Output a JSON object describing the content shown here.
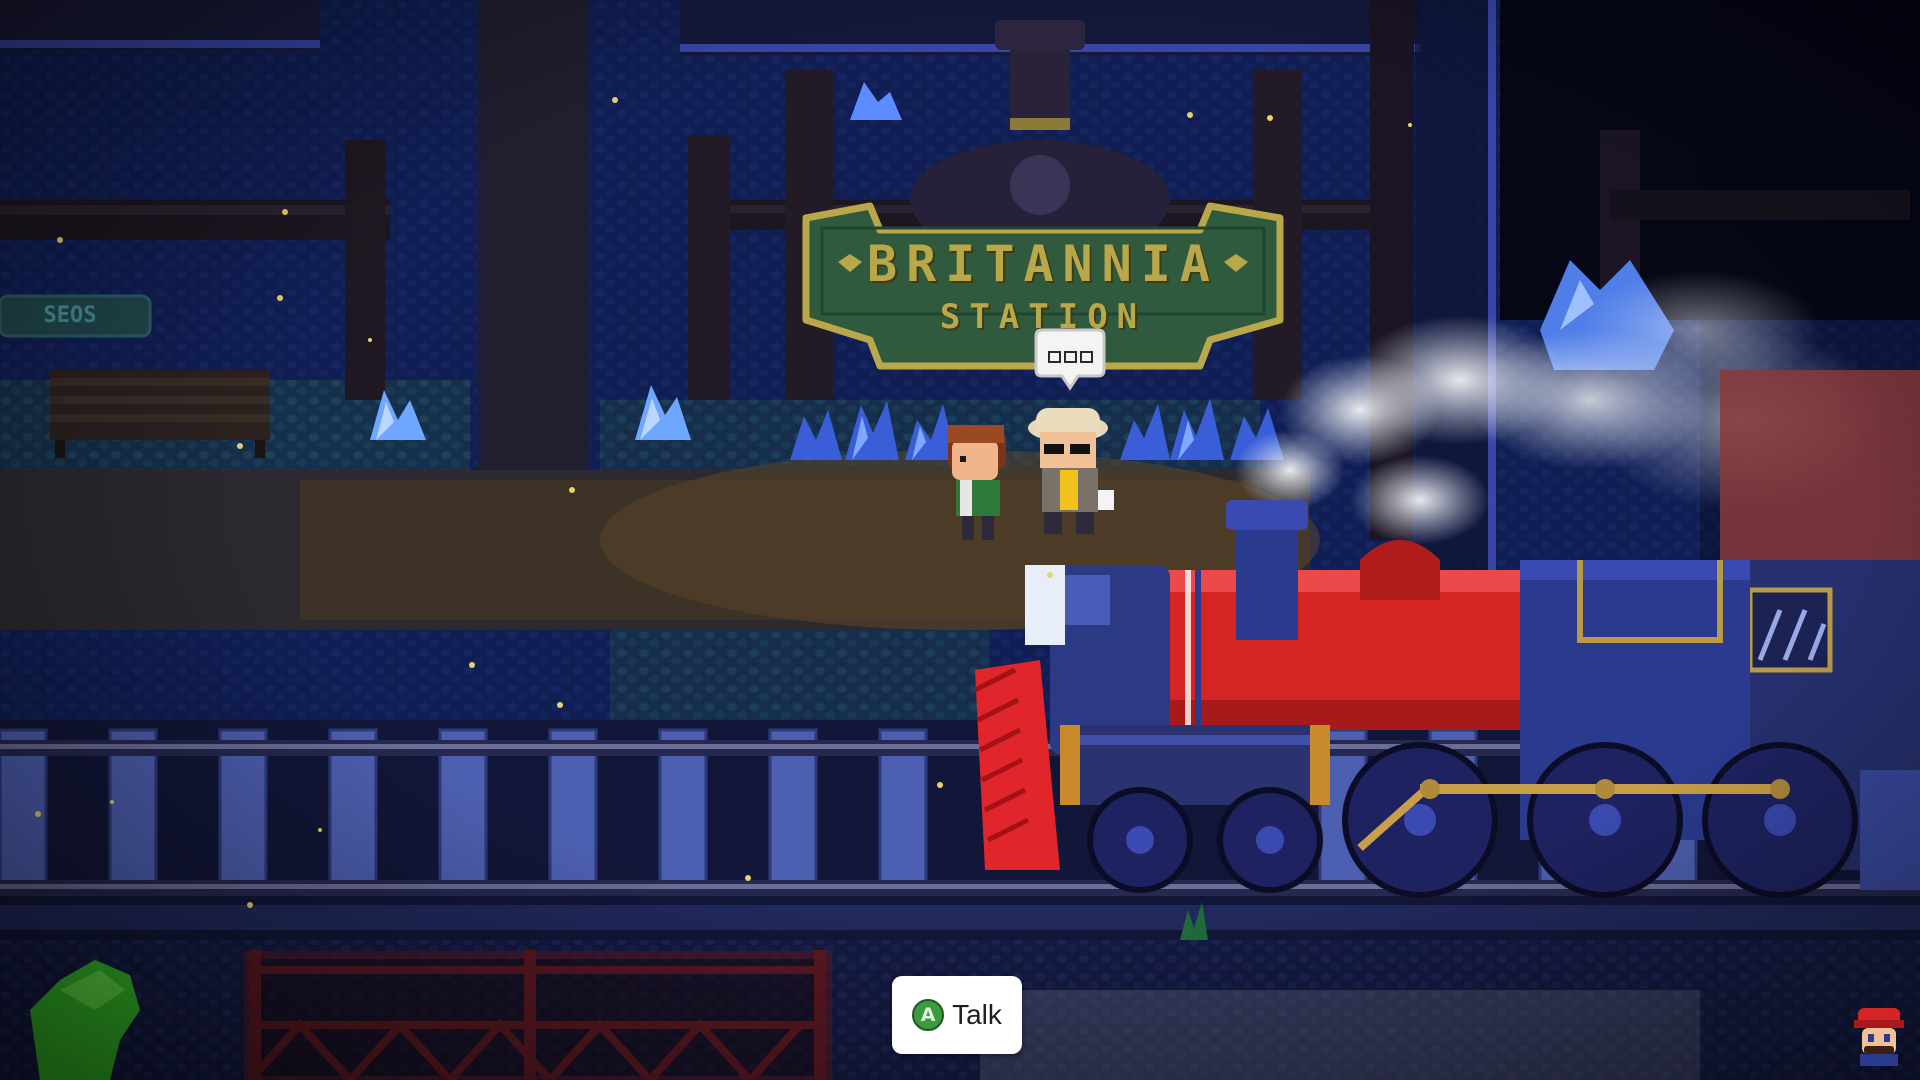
{
  "station_sign": {
    "line1": "BRITANNIA",
    "line2": "STATION"
  },
  "left_sign": {
    "text": "SEOS"
  },
  "speech_bubble": {
    "icon": "ellipsis-icon"
  },
  "interaction_prompt": {
    "button": "A",
    "action": "Talk",
    "button_icon": "a-button-icon"
  },
  "colors": {
    "night_ground": "#16205a",
    "dirt_path": "#3f3424",
    "sign_panel": "#2f5a3e",
    "sign_gold": "#b9a84a",
    "locomotive_red": "#d42424",
    "locomotive_blue": "#2a3a8e",
    "prompt_bg": "#ffffff",
    "a_button_green": "#3c9a3f"
  }
}
